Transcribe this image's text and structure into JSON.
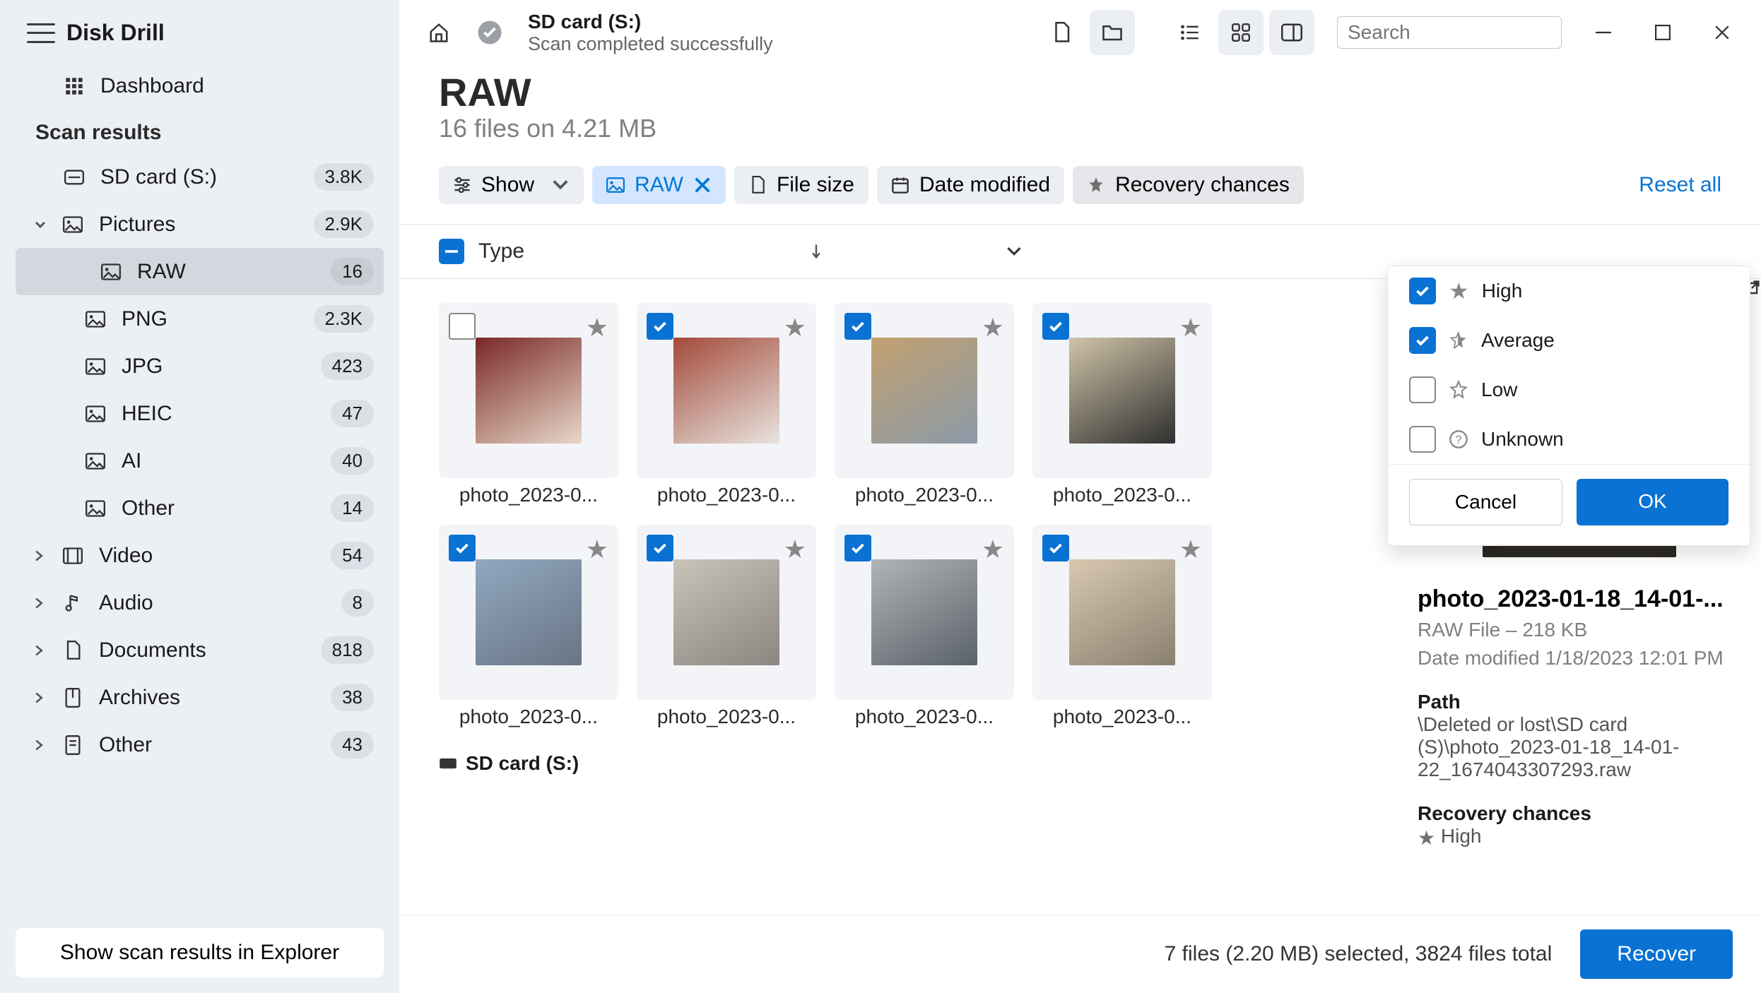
{
  "app_title": "Disk Drill",
  "sidebar": {
    "dashboard": "Dashboard",
    "section": "Scan results",
    "drive": {
      "label": "SD card (S:)",
      "count": "3.8K"
    },
    "pictures": {
      "label": "Pictures",
      "count": "2.9K"
    },
    "pic_children": [
      {
        "label": "RAW",
        "count": "16",
        "active": true
      },
      {
        "label": "PNG",
        "count": "2.3K"
      },
      {
        "label": "JPG",
        "count": "423"
      },
      {
        "label": "HEIC",
        "count": "47"
      },
      {
        "label": "AI",
        "count": "40"
      },
      {
        "label": "Other",
        "count": "14"
      }
    ],
    "video": {
      "label": "Video",
      "count": "54"
    },
    "audio": {
      "label": "Audio",
      "count": "8"
    },
    "documents": {
      "label": "Documents",
      "count": "818"
    },
    "archives": {
      "label": "Archives",
      "count": "38"
    },
    "other": {
      "label": "Other",
      "count": "43"
    },
    "bottom_button": "Show scan results in Explorer"
  },
  "header": {
    "title": "SD card (S:)",
    "subtitle": "Scan completed successfully",
    "search_placeholder": "Search"
  },
  "content": {
    "title": "RAW",
    "subtitle": "16 files on 4.21 MB"
  },
  "filters": {
    "show": "Show",
    "raw": "RAW",
    "file_size": "File size",
    "date_modified": "Date modified",
    "recovery": "Recovery chances",
    "reset": "Reset all"
  },
  "sort_col": "Type",
  "files": [
    {
      "name": "photo_2023-0...",
      "checked": false,
      "hue1": "#7a2828",
      "hue2": "#e8d8c8"
    },
    {
      "name": "photo_2023-0...",
      "checked": true,
      "hue1": "#a34a3a",
      "hue2": "#e8e4df"
    },
    {
      "name": "photo_2023-0...",
      "checked": true,
      "hue1": "#c2a070",
      "hue2": "#8b9aa8"
    },
    {
      "name": "photo_2023-0...",
      "checked": true,
      "hue1": "#d0c4a8",
      "hue2": "#2f2f2f"
    },
    {
      "name": "photo_2023-0...",
      "checked": true,
      "hue1": "#90a8c0",
      "hue2": "#6a7485"
    },
    {
      "name": "photo_2023-0...",
      "checked": true,
      "hue1": "#c8c4b8",
      "hue2": "#8a8681"
    },
    {
      "name": "photo_2023-0...",
      "checked": true,
      "hue1": "#b0b4b8",
      "hue2": "#5a6268"
    },
    {
      "name": "photo_2023-0...",
      "checked": true,
      "hue1": "#d8c8b0",
      "hue2": "#8a8070"
    }
  ],
  "group_label": "SD card (S:)",
  "details": {
    "filename": "photo_2023-01-18_14-01-...",
    "file_type": "RAW File – 218 KB",
    "modified": "Date modified 1/18/2023 12:01 PM",
    "path_label": "Path",
    "path_value": "\\Deleted or lost\\SD card (S)\\photo_2023-01-18_14-01-22_1674043307293.raw",
    "recovery_label": "Recovery chances",
    "recovery_value": "High"
  },
  "footer": {
    "summary": "7 files (2.20 MB) selected, 3824 files total",
    "recover": "Recover"
  },
  "popover": {
    "high": "High",
    "average": "Average",
    "low": "Low",
    "unknown": "Unknown",
    "high_checked": true,
    "average_checked": true,
    "low_checked": false,
    "unknown_checked": false,
    "cancel": "Cancel",
    "ok": "OK"
  }
}
